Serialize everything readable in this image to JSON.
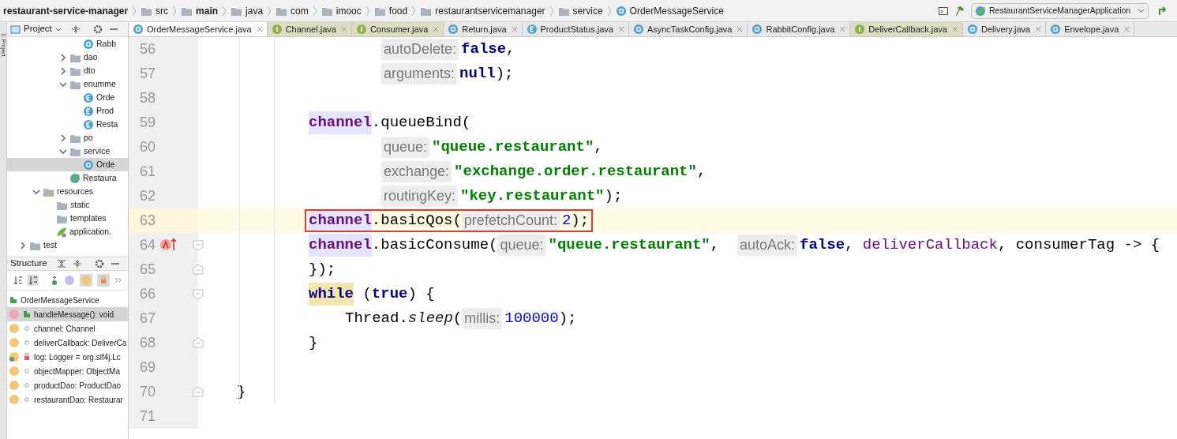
{
  "breadcrumbs": [
    {
      "label": "restaurant-service-manager",
      "kind": "project"
    },
    {
      "label": "src",
      "kind": "folder"
    },
    {
      "label": "main",
      "kind": "source-root"
    },
    {
      "label": "java",
      "kind": "java-folder"
    },
    {
      "label": "com",
      "kind": "folder"
    },
    {
      "label": "imooc",
      "kind": "folder"
    },
    {
      "label": "food",
      "kind": "folder"
    },
    {
      "label": "restaurantservicemanager",
      "kind": "folder"
    },
    {
      "label": "service",
      "kind": "folder"
    },
    {
      "label": "OrderMessageService",
      "kind": "class"
    }
  ],
  "run_config": {
    "label": "RestaurantServiceManagerApplication"
  },
  "side_strip": {
    "label": "1: Project"
  },
  "project_panel": {
    "title": "Project",
    "tree": [
      {
        "children": [
          {
            "children": [
              {
                "children": [
                  {
                    "children": [
                      {
                        "label": "Rabb",
                        "kind": "class",
                        "selected": false
                      }
                    ]
                  },
                  {
                    "label": "dao",
                    "kind": "folder",
                    "expanded": false,
                    "selected": false
                  },
                  {
                    "label": "dto",
                    "kind": "folder",
                    "expanded": false,
                    "selected": false
                  },
                  {
                    "label": "enumme",
                    "kind": "folder",
                    "expanded": true,
                    "selected": false,
                    "children": [
                      {
                        "label": "Orde",
                        "kind": "enum",
                        "selected": false
                      },
                      {
                        "label": "Prod",
                        "kind": "enum",
                        "selected": false
                      },
                      {
                        "label": "Resta",
                        "kind": "enum",
                        "selected": false
                      }
                    ]
                  },
                  {
                    "label": "po",
                    "kind": "folder",
                    "expanded": false,
                    "selected": false
                  },
                  {
                    "label": "service",
                    "kind": "folder",
                    "expanded": true,
                    "selected": false,
                    "children": [
                      {
                        "label": "Orde",
                        "kind": "class",
                        "selected": true
                      }
                    ]
                  },
                  {
                    "label": "Restaura",
                    "kind": "app",
                    "selected": false
                  }
                ]
              }
            ]
          },
          {
            "label": "resources",
            "kind": "resources",
            "expanded": true,
            "selected": false,
            "children": [
              {
                "label": "static",
                "kind": "plain-folder",
                "selected": false
              },
              {
                "label": "templates",
                "kind": "plain-folder",
                "selected": false
              },
              {
                "label": "application.",
                "kind": "config",
                "selected": false
              }
            ]
          }
        ]
      },
      {
        "label": "test",
        "kind": "folder",
        "expanded": false,
        "selected": false
      }
    ]
  },
  "structure_panel": {
    "title": "Structure",
    "items": [
      {
        "label": "OrderMessageService",
        "kind": "class",
        "selected": false,
        "children": [
          {
            "label": "handleMessage(): void",
            "kind": "public-method",
            "selected": true
          },
          {
            "label": "channel: Channel",
            "kind": "field",
            "selected": false
          },
          {
            "label": "deliverCallback: DeliverCa",
            "kind": "field",
            "selected": false
          },
          {
            "label": "log: Logger = org.slf4j.Lc",
            "kind": "private-static-field",
            "selected": false
          },
          {
            "label": "objectMapper: ObjectMa",
            "kind": "field",
            "selected": false
          },
          {
            "label": "productDao: ProductDao",
            "kind": "field",
            "selected": false
          },
          {
            "label": "restaurantDao: Restaurar",
            "kind": "field",
            "selected": false
          }
        ]
      }
    ]
  },
  "tabs": [
    {
      "label": "OrderMessageService.java",
      "kind": "class",
      "selected": true
    },
    {
      "label": "Channel.java",
      "kind": "interface",
      "selected": false
    },
    {
      "label": "Consumer.java",
      "kind": "interface",
      "selected": false
    },
    {
      "label": "Return.java",
      "kind": "class",
      "selected": false
    },
    {
      "label": "ProductStatus.java",
      "kind": "enum",
      "selected": false
    },
    {
      "label": "AsyncTaskConfig.java",
      "kind": "class",
      "selected": false
    },
    {
      "label": "RabbitConfig.java",
      "kind": "class",
      "selected": false
    },
    {
      "label": "DeliverCallback.java",
      "kind": "interface",
      "selected": false
    },
    {
      "label": "Delivery.java",
      "kind": "class",
      "selected": false
    },
    {
      "label": "Envelope.java",
      "kind": "class",
      "selected": false
    }
  ],
  "editor": {
    "lines": [
      {
        "number": "56",
        "current": false,
        "kind": "continuation",
        "tokens": [
          {
            "t": "autoDelete:",
            "kind": "hint"
          },
          {
            "t": "false",
            "kind": "keyword"
          },
          {
            "t": ",",
            "kind": "plain"
          }
        ]
      },
      {
        "number": "57",
        "current": false,
        "kind": "continuation",
        "tokens": [
          {
            "t": "arguments:",
            "kind": "hint"
          },
          {
            "t": "null",
            "kind": "keyword"
          },
          {
            "t": ");",
            "kind": "plain"
          }
        ]
      },
      {
        "number": "58",
        "current": false,
        "kind": "blank"
      },
      {
        "number": "59",
        "current": false,
        "kind": "body",
        "tokens": [
          {
            "t": "channel",
            "kind": "usage"
          },
          {
            "t": ".queueBind(",
            "kind": "plain"
          }
        ]
      },
      {
        "number": "60",
        "current": false,
        "kind": "continuation",
        "tokens": [
          {
            "t": "queue:",
            "kind": "hint"
          },
          {
            "t": "\"queue.restaurant\"",
            "kind": "string"
          },
          {
            "t": ",",
            "kind": "plain"
          }
        ]
      },
      {
        "number": "61",
        "current": false,
        "kind": "continuation",
        "tokens": [
          {
            "t": "exchange:",
            "kind": "hint"
          },
          {
            "t": "\"exchange.order.restaurant\"",
            "kind": "string"
          },
          {
            "t": ",",
            "kind": "plain"
          }
        ]
      },
      {
        "number": "62",
        "current": false,
        "kind": "continuation",
        "tokens": [
          {
            "t": "routingKey:",
            "kind": "hint"
          },
          {
            "t": "\"key.restaurant\"",
            "kind": "string"
          },
          {
            "t": ");",
            "kind": "plain"
          }
        ]
      },
      {
        "number": "63",
        "current": true,
        "boxed": true,
        "kind": "body",
        "tokens": [
          {
            "t": "channel",
            "kind": "usage"
          },
          {
            "t": ".basicQos(",
            "kind": "plain"
          },
          {
            "t": "prefetchCount:",
            "kind": "hint"
          },
          {
            "t": "2",
            "kind": "number"
          },
          {
            "t": ");",
            "kind": "plain"
          }
        ]
      },
      {
        "number": "64",
        "current": false,
        "marker": true,
        "fold_start": true,
        "kind": "body",
        "tokens": [
          {
            "t": "channel",
            "kind": "usage"
          },
          {
            "t": ".basicConsume(",
            "kind": "plain"
          },
          {
            "t": "queue:",
            "kind": "hint"
          },
          {
            "t": "\"queue.restaurant\"",
            "kind": "string"
          },
          {
            "t": ",  ",
            "kind": "plain"
          },
          {
            "t": "autoAck:",
            "kind": "hint"
          },
          {
            "t": "false",
            "kind": "keyword"
          },
          {
            "t": ", ",
            "kind": "plain"
          },
          {
            "t": "deliverCallback",
            "kind": "field"
          },
          {
            "t": ", consumerTag -> {",
            "kind": "plain"
          }
        ]
      },
      {
        "number": "65",
        "current": false,
        "fold_end": true,
        "kind": "body",
        "tokens": [
          {
            "t": "});",
            "kind": "plain"
          }
        ]
      },
      {
        "number": "66",
        "current": false,
        "fold_start": true,
        "kind": "body",
        "tokens": [
          {
            "t": "while",
            "kind": "keyword-match"
          },
          {
            "t": " (",
            "kind": "plain"
          },
          {
            "t": "true",
            "kind": "keyword"
          },
          {
            "t": ") {",
            "kind": "plain"
          }
        ]
      },
      {
        "number": "67",
        "current": false,
        "kind": "nested",
        "tokens": [
          {
            "t": "Thread.",
            "kind": "plain"
          },
          {
            "t": "sleep",
            "kind": "static"
          },
          {
            "t": "(",
            "kind": "plain"
          },
          {
            "t": "millis:",
            "kind": "hint"
          },
          {
            "t": "100000",
            "kind": "number"
          },
          {
            "t": ");",
            "kind": "plain"
          }
        ]
      },
      {
        "number": "68",
        "current": false,
        "fold_end": true,
        "kind": "body",
        "tokens": [
          {
            "t": "}",
            "kind": "plain"
          }
        ]
      },
      {
        "number": "69",
        "current": false,
        "kind": "blank"
      },
      {
        "number": "70",
        "current": false,
        "fold_end": true,
        "kind": "top",
        "tokens": [
          {
            "t": "}",
            "kind": "plain"
          }
        ]
      },
      {
        "number": "71",
        "current": false,
        "kind": "blank"
      }
    ]
  }
}
